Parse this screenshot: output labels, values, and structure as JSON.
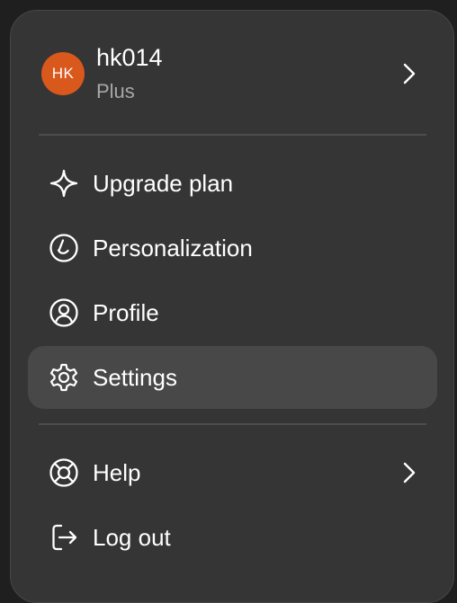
{
  "account": {
    "avatar_initials": "HK",
    "avatar_color": "#d9581c",
    "username": "hk014",
    "plan": "Plus",
    "chevron_icon": "chevron-right-icon"
  },
  "menu_items": [
    {
      "label": "Upgrade plan",
      "icon": "sparkle-icon"
    },
    {
      "label": "Personalization",
      "icon": "personalization-icon"
    },
    {
      "label": "Profile",
      "icon": "user-circle-icon"
    },
    {
      "label": "Settings",
      "icon": "gear-icon",
      "selected": true
    },
    {
      "label": "Help",
      "icon": "lifebuoy-icon",
      "has_submenu": true
    },
    {
      "label": "Log out",
      "icon": "logout-icon"
    }
  ],
  "colors": {
    "background": "#353535",
    "selected_background": "#484848",
    "text": "#ffffff",
    "secondary_text": "#a8a8a8"
  }
}
